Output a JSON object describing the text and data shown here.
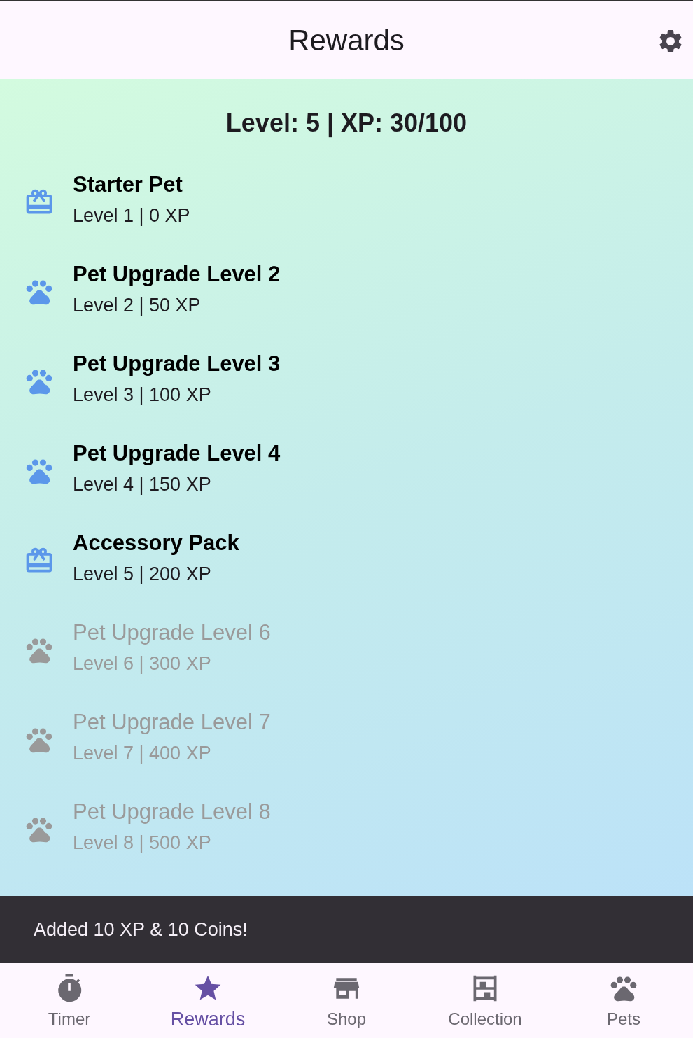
{
  "app_bar": {
    "title": "Rewards"
  },
  "progress": {
    "text": "Level: 5 | XP: 30/100"
  },
  "rewards": [
    {
      "kind": "gift",
      "title": "Starter Pet",
      "subtitle": "Level 1 | 0 XP",
      "unlocked": true
    },
    {
      "kind": "paw",
      "title": "Pet Upgrade Level 2",
      "subtitle": "Level 2 | 50 XP",
      "unlocked": true
    },
    {
      "kind": "paw",
      "title": "Pet Upgrade Level 3",
      "subtitle": "Level 3 | 100 XP",
      "unlocked": true
    },
    {
      "kind": "paw",
      "title": "Pet Upgrade Level 4",
      "subtitle": "Level 4 | 150 XP",
      "unlocked": true
    },
    {
      "kind": "gift",
      "title": "Accessory Pack",
      "subtitle": "Level 5 | 200 XP",
      "unlocked": true
    },
    {
      "kind": "paw",
      "title": "Pet Upgrade Level 6",
      "subtitle": "Level 6 | 300 XP",
      "unlocked": false
    },
    {
      "kind": "paw",
      "title": "Pet Upgrade Level 7",
      "subtitle": "Level 7 | 400 XP",
      "unlocked": false
    },
    {
      "kind": "paw",
      "title": "Pet Upgrade Level 8",
      "subtitle": "Level 8 | 500 XP",
      "unlocked": false
    }
  ],
  "snackbar": {
    "message": "Added 10 XP & 10 Coins!"
  },
  "nav": [
    {
      "kind": "timer",
      "label": "Timer",
      "selected": false
    },
    {
      "kind": "star",
      "label": "Rewards",
      "selected": true
    },
    {
      "kind": "shop",
      "label": "Shop",
      "selected": false
    },
    {
      "kind": "shelf",
      "label": "Collection",
      "selected": false
    },
    {
      "kind": "paw",
      "label": "Pets",
      "selected": false
    }
  ]
}
